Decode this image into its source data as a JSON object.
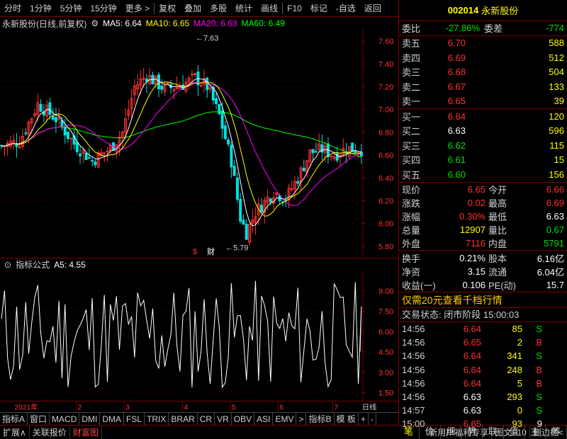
{
  "toolbar": [
    "分时",
    "1分钟",
    "5分钟",
    "15分钟",
    "更多 >",
    "复权",
    "叠加",
    "多股",
    "统计",
    "画线",
    "F10",
    "标记",
    "-自选",
    "返回"
  ],
  "chart_title": {
    "stock": "永新股份(日线,前复权)",
    "ma5": "MA5: 6.64",
    "ma10": "MA10: 6.65",
    "ma20": "MA20: 6.63",
    "ma60": "MA60: 6.49"
  },
  "price_axis": [
    "7.60",
    "7.40",
    "7.20",
    "7.00",
    "6.80",
    "6.60",
    "6.40",
    "6.20",
    "6.00",
    "5.80"
  ],
  "annotations": {
    "high": "7.63",
    "low": "5.79",
    "marker1": "$",
    "marker2": "财"
  },
  "indicator": {
    "title": "指标公式",
    "value": "A5: 4.55",
    "axis": [
      "9.00",
      "7.50",
      "6.00",
      "4.50",
      "3.00",
      "1.50"
    ]
  },
  "xaxis": {
    "year": "2021年",
    "months": [
      "2",
      "3",
      "4",
      "5",
      "6",
      "7"
    ],
    "period": "日线"
  },
  "bottom_tabs": [
    "指标A",
    "窗口",
    "MACD",
    "DMI",
    "DMA",
    "FSL",
    "TRIX",
    "BRAR",
    "CR",
    "VR",
    "OBV",
    "ASI",
    "EMV",
    ">",
    "指标B",
    "模 板",
    "+",
    "-"
  ],
  "status_bar": [
    "扩展∧",
    "关联报价",
    "财富图",
    "新用户福利专享",
    "图文F10",
    "侧边栏<"
  ],
  "quote": {
    "code": "002014",
    "name": "永新股份",
    "weibi_label": "委比",
    "weibi": "-27.86%",
    "weicha_label": "委差",
    "weicha": "-774",
    "sells": [
      {
        "label": "卖五",
        "price": "6.70",
        "vol": "588"
      },
      {
        "label": "卖四",
        "price": "6.69",
        "vol": "512"
      },
      {
        "label": "卖三",
        "price": "6.68",
        "vol": "504"
      },
      {
        "label": "卖二",
        "price": "6.67",
        "vol": "133"
      },
      {
        "label": "卖一",
        "price": "6.65",
        "vol": "39"
      }
    ],
    "buys": [
      {
        "label": "买一",
        "price": "6.64",
        "vol": "120"
      },
      {
        "label": "买二",
        "price": "6.63",
        "vol": "596"
      },
      {
        "label": "买三",
        "price": "6.62",
        "vol": "115"
      },
      {
        "label": "买四",
        "price": "6.61",
        "vol": "15"
      },
      {
        "label": "买五",
        "price": "6.60",
        "vol": "156"
      }
    ],
    "stats": [
      {
        "l1": "现价",
        "v1": "6.65",
        "l2": "今开",
        "v2": "6.66"
      },
      {
        "l1": "涨跌",
        "v1": "0.02",
        "l2": "最高",
        "v2": "6.69"
      },
      {
        "l1": "涨幅",
        "v1": "0.30%",
        "l2": "最低",
        "v2": "6.63"
      },
      {
        "l1": "总量",
        "v1": "12907",
        "l2": "量比",
        "v2": "0.67"
      },
      {
        "l1": "外盘",
        "v1": "7116",
        "l2": "内盘",
        "v2": "5791"
      }
    ],
    "fundamentals": [
      {
        "l1": "换手",
        "v1": "0.21%",
        "l2": "股本",
        "v2": "6.16亿"
      },
      {
        "l1": "净资",
        "v1": "3.15",
        "l2": "流通",
        "v2": "6.04亿"
      },
      {
        "l1": "收益(一)",
        "v1": "0.106",
        "l2": "PE(动)",
        "v2": "15.7"
      }
    ],
    "promo": "仅需20元查看千档行情",
    "trade_status": "交易状态: 闭市阶段 15:00:03",
    "ticks": [
      {
        "t": "14:56",
        "p": "6.64",
        "v": "85",
        "bs": "S"
      },
      {
        "t": "14:56",
        "p": "6.65",
        "v": "2",
        "bs": "B"
      },
      {
        "t": "14:56",
        "p": "6.64",
        "v": "341",
        "bs": "S"
      },
      {
        "t": "14:56",
        "p": "6.64",
        "v": "248",
        "bs": "B"
      },
      {
        "t": "14:56",
        "p": "6.64",
        "v": "5",
        "bs": "B"
      },
      {
        "t": "14:56",
        "p": "6.63",
        "v": "293",
        "bs": "S"
      },
      {
        "t": "14:57",
        "p": "6.63",
        "v": "0",
        "bs": "S"
      },
      {
        "t": "15:00",
        "p": "6.65",
        "v": "93",
        "bs": "9"
      }
    ]
  },
  "side_tabs": [
    "笔",
    "价",
    "细",
    "势",
    "联",
    "值",
    "主",
    "筹"
  ],
  "colors": {
    "up": "#ff3030",
    "down": "#00e000",
    "ma5": "#ffffff",
    "ma10": "#ffff00",
    "ma20": "#ff00ff",
    "ma60": "#00ff00",
    "border": "#7a0000"
  }
}
